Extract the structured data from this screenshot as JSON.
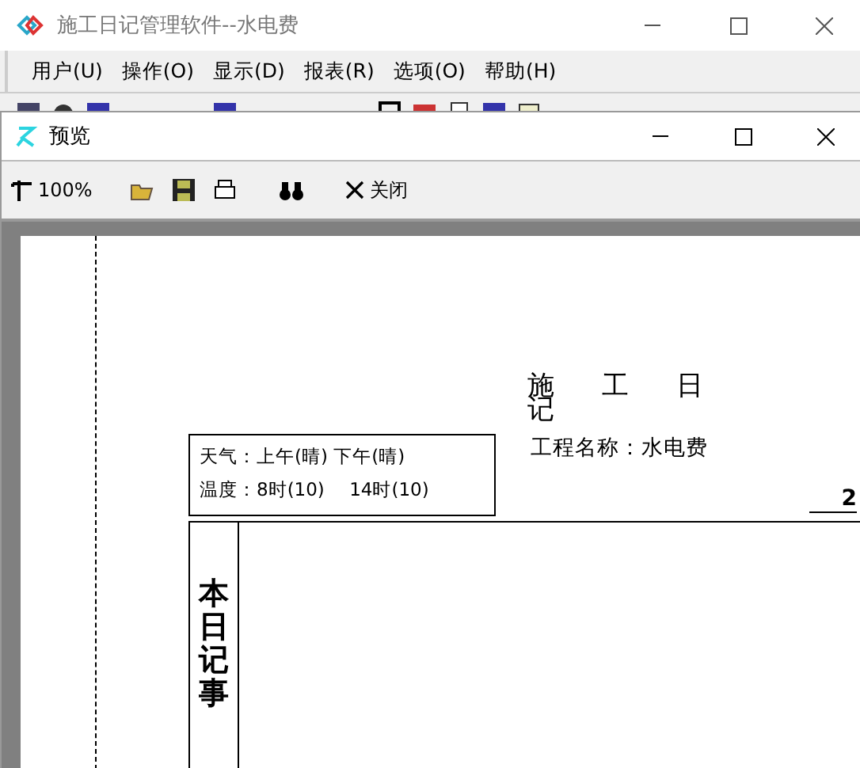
{
  "main_window": {
    "title": "施工日记管理软件--水电费",
    "menu": [
      "用户(U)",
      "操作(O)",
      "显示(D)",
      "报表(R)",
      "选项(O)",
      "帮助(H)"
    ]
  },
  "preview": {
    "title": "预览",
    "toolbar": {
      "zoom": "100%",
      "close": "关闭"
    },
    "page": {
      "title": "施工日记",
      "project": "工程名称：水电费",
      "page_number": "2",
      "weather": "天气：上午(晴) 下午(晴)",
      "temperature": "温度：8时(10)　 14时(10)",
      "section": "本日记事"
    }
  }
}
